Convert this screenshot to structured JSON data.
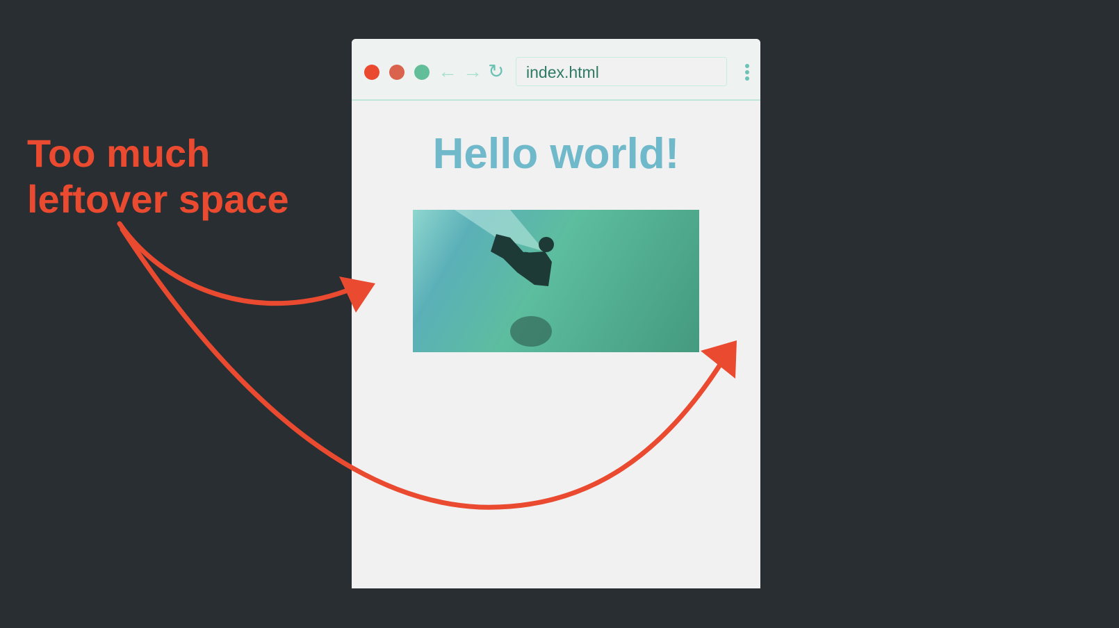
{
  "browser": {
    "url": "index.html",
    "icons": [
      "close-dot",
      "minimize-dot",
      "maximize-dot",
      "back-arrow-icon",
      "forward-arrow-icon",
      "reload-icon",
      "kebab-menu-icon"
    ],
    "colors": {
      "close": "#ea4a2f",
      "minimize": "#d9634c",
      "maximize": "#62be99"
    }
  },
  "page": {
    "heading": "Hello world!",
    "image": "surfer-photo"
  },
  "annotation": {
    "line1": "Too much",
    "line2": "leftover space",
    "color": "#ea4a2f"
  }
}
